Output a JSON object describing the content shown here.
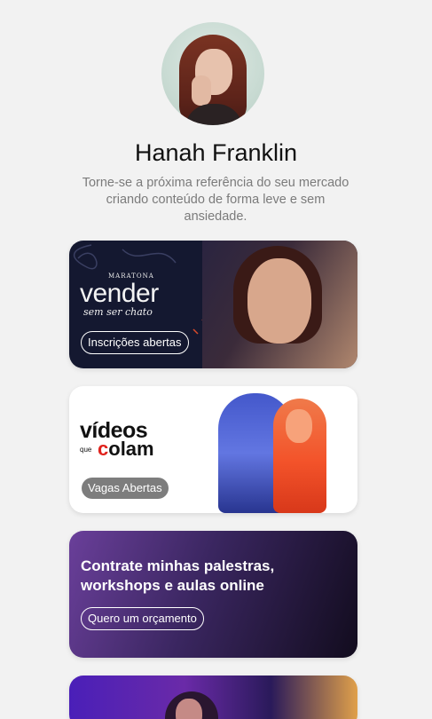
{
  "profile": {
    "name": "Hanah Franklin",
    "bio": "Torne-se a próxima referência do seu mercado criando conteúdo de forma leve e sem ansiedade."
  },
  "cards": [
    {
      "kicker": "MARATONA",
      "title": "vender",
      "subtitle": "sem ser chato",
      "button": "Inscrições abertas"
    },
    {
      "logo_line1": "vídeos",
      "logo_small": "que",
      "logo_line2_accent": "c",
      "logo_line2_rest": "olam",
      "button": "Vagas Abertas"
    },
    {
      "title": "Contrate minhas palestras, workshops e aulas online",
      "button": "Quero um orçamento"
    }
  ],
  "colors": {
    "background": "#f2f2f2",
    "name_text": "#111111",
    "bio_text": "#7b7b7b",
    "accent_red": "#e0231d"
  }
}
